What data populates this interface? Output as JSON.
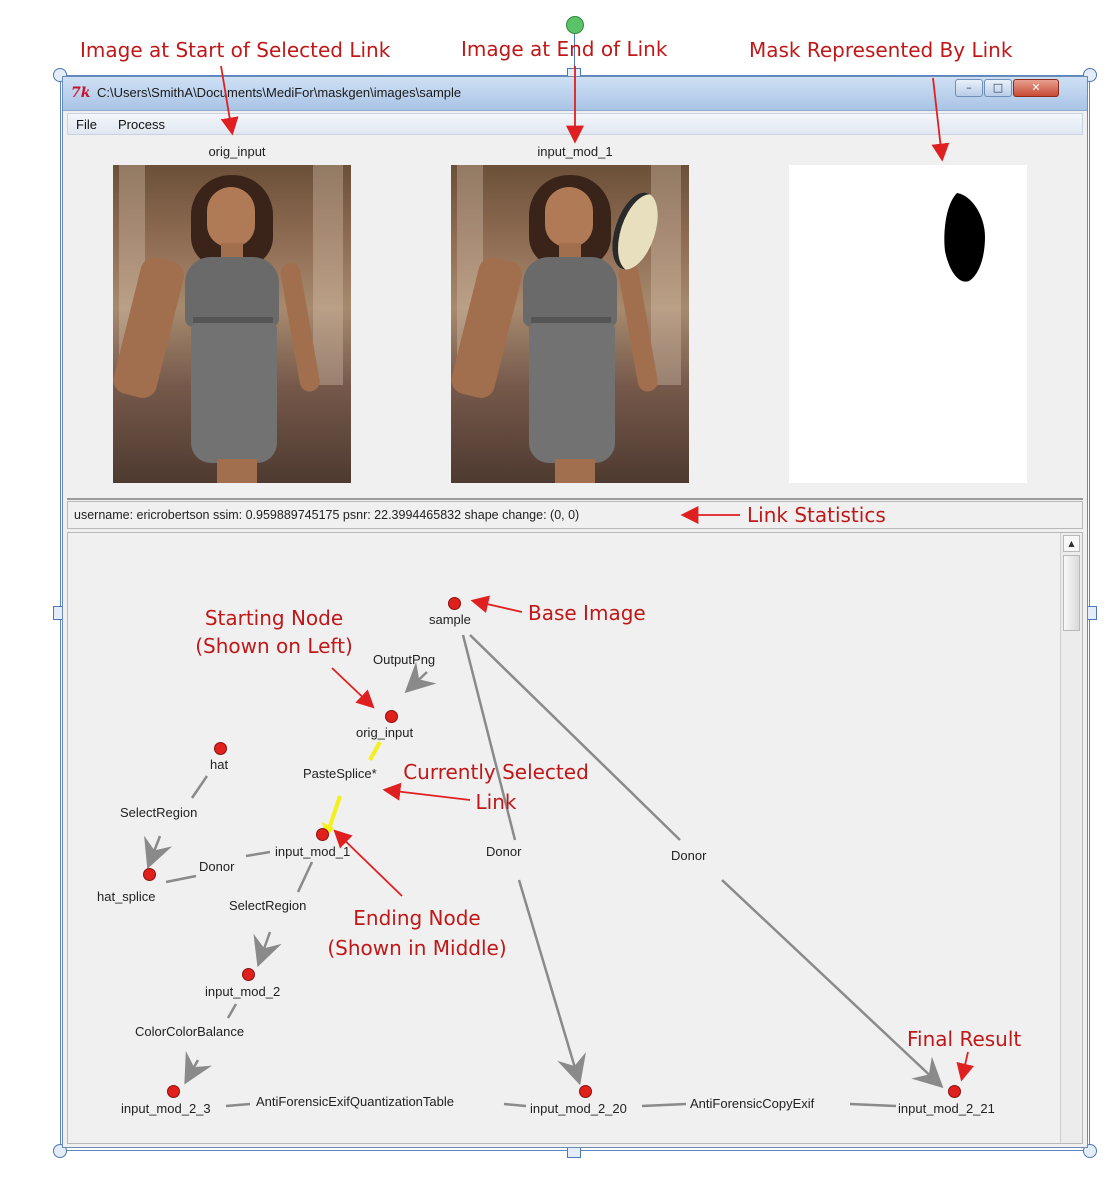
{
  "callouts": {
    "start_image": "Image at Start of Selected Link",
    "end_image": "Image at End of Link",
    "mask": "Mask Represented By Link",
    "link_statistics": "Link Statistics",
    "starting_node_line1": "Starting Node",
    "starting_node_line2": "(Shown on Left)",
    "base_image": "Base Image",
    "selected_link_line1": "Currently Selected",
    "selected_link_line2": "Link",
    "ending_node_line1": "Ending Node",
    "ending_node_line2": "(Shown in Middle)",
    "final_result": "Final Result"
  },
  "window": {
    "app_icon": "7k",
    "title": "C:\\Users\\SmithA\\Documents\\MediFor\\maskgen\\images\\sample"
  },
  "menu": {
    "items": [
      "File",
      "Process"
    ]
  },
  "images": {
    "left_label": "orig_input",
    "middle_label": "input_mod_1"
  },
  "status": {
    "text": "username: ericrobertson   ssim: 0.959889745175   psnr: 22.3994465832   shape change: (0, 0)"
  },
  "graph": {
    "nodes": {
      "sample": "sample",
      "orig_input": "orig_input",
      "hat": "hat",
      "hat_splice": "hat_splice",
      "input_mod_1": "input_mod_1",
      "input_mod_2": "input_mod_2",
      "input_mod_2_3": "input_mod_2_3",
      "input_mod_2_20": "input_mod_2_20",
      "input_mod_2_21": "input_mod_2_21"
    },
    "edges": {
      "output_png": "OutputPng",
      "paste_splice": "PasteSplice*",
      "select_region_hat": "SelectRegion",
      "donor_hat": "Donor",
      "select_region_mod": "SelectRegion",
      "color_balance": "ColorColorBalance",
      "anti_forensic_quant": "AntiForensicExifQuantizationTable",
      "anti_forensic_copy": "AntiForensicCopyExif",
      "donor_mid": "Donor",
      "donor_right": "Donor"
    },
    "colors": {
      "node": "#e0201c",
      "edge": "#8a8a8a",
      "selected_edge": "#f5f01a"
    }
  },
  "colors": {
    "callout": "#c01818",
    "selection_frame": "#4c78b8"
  }
}
